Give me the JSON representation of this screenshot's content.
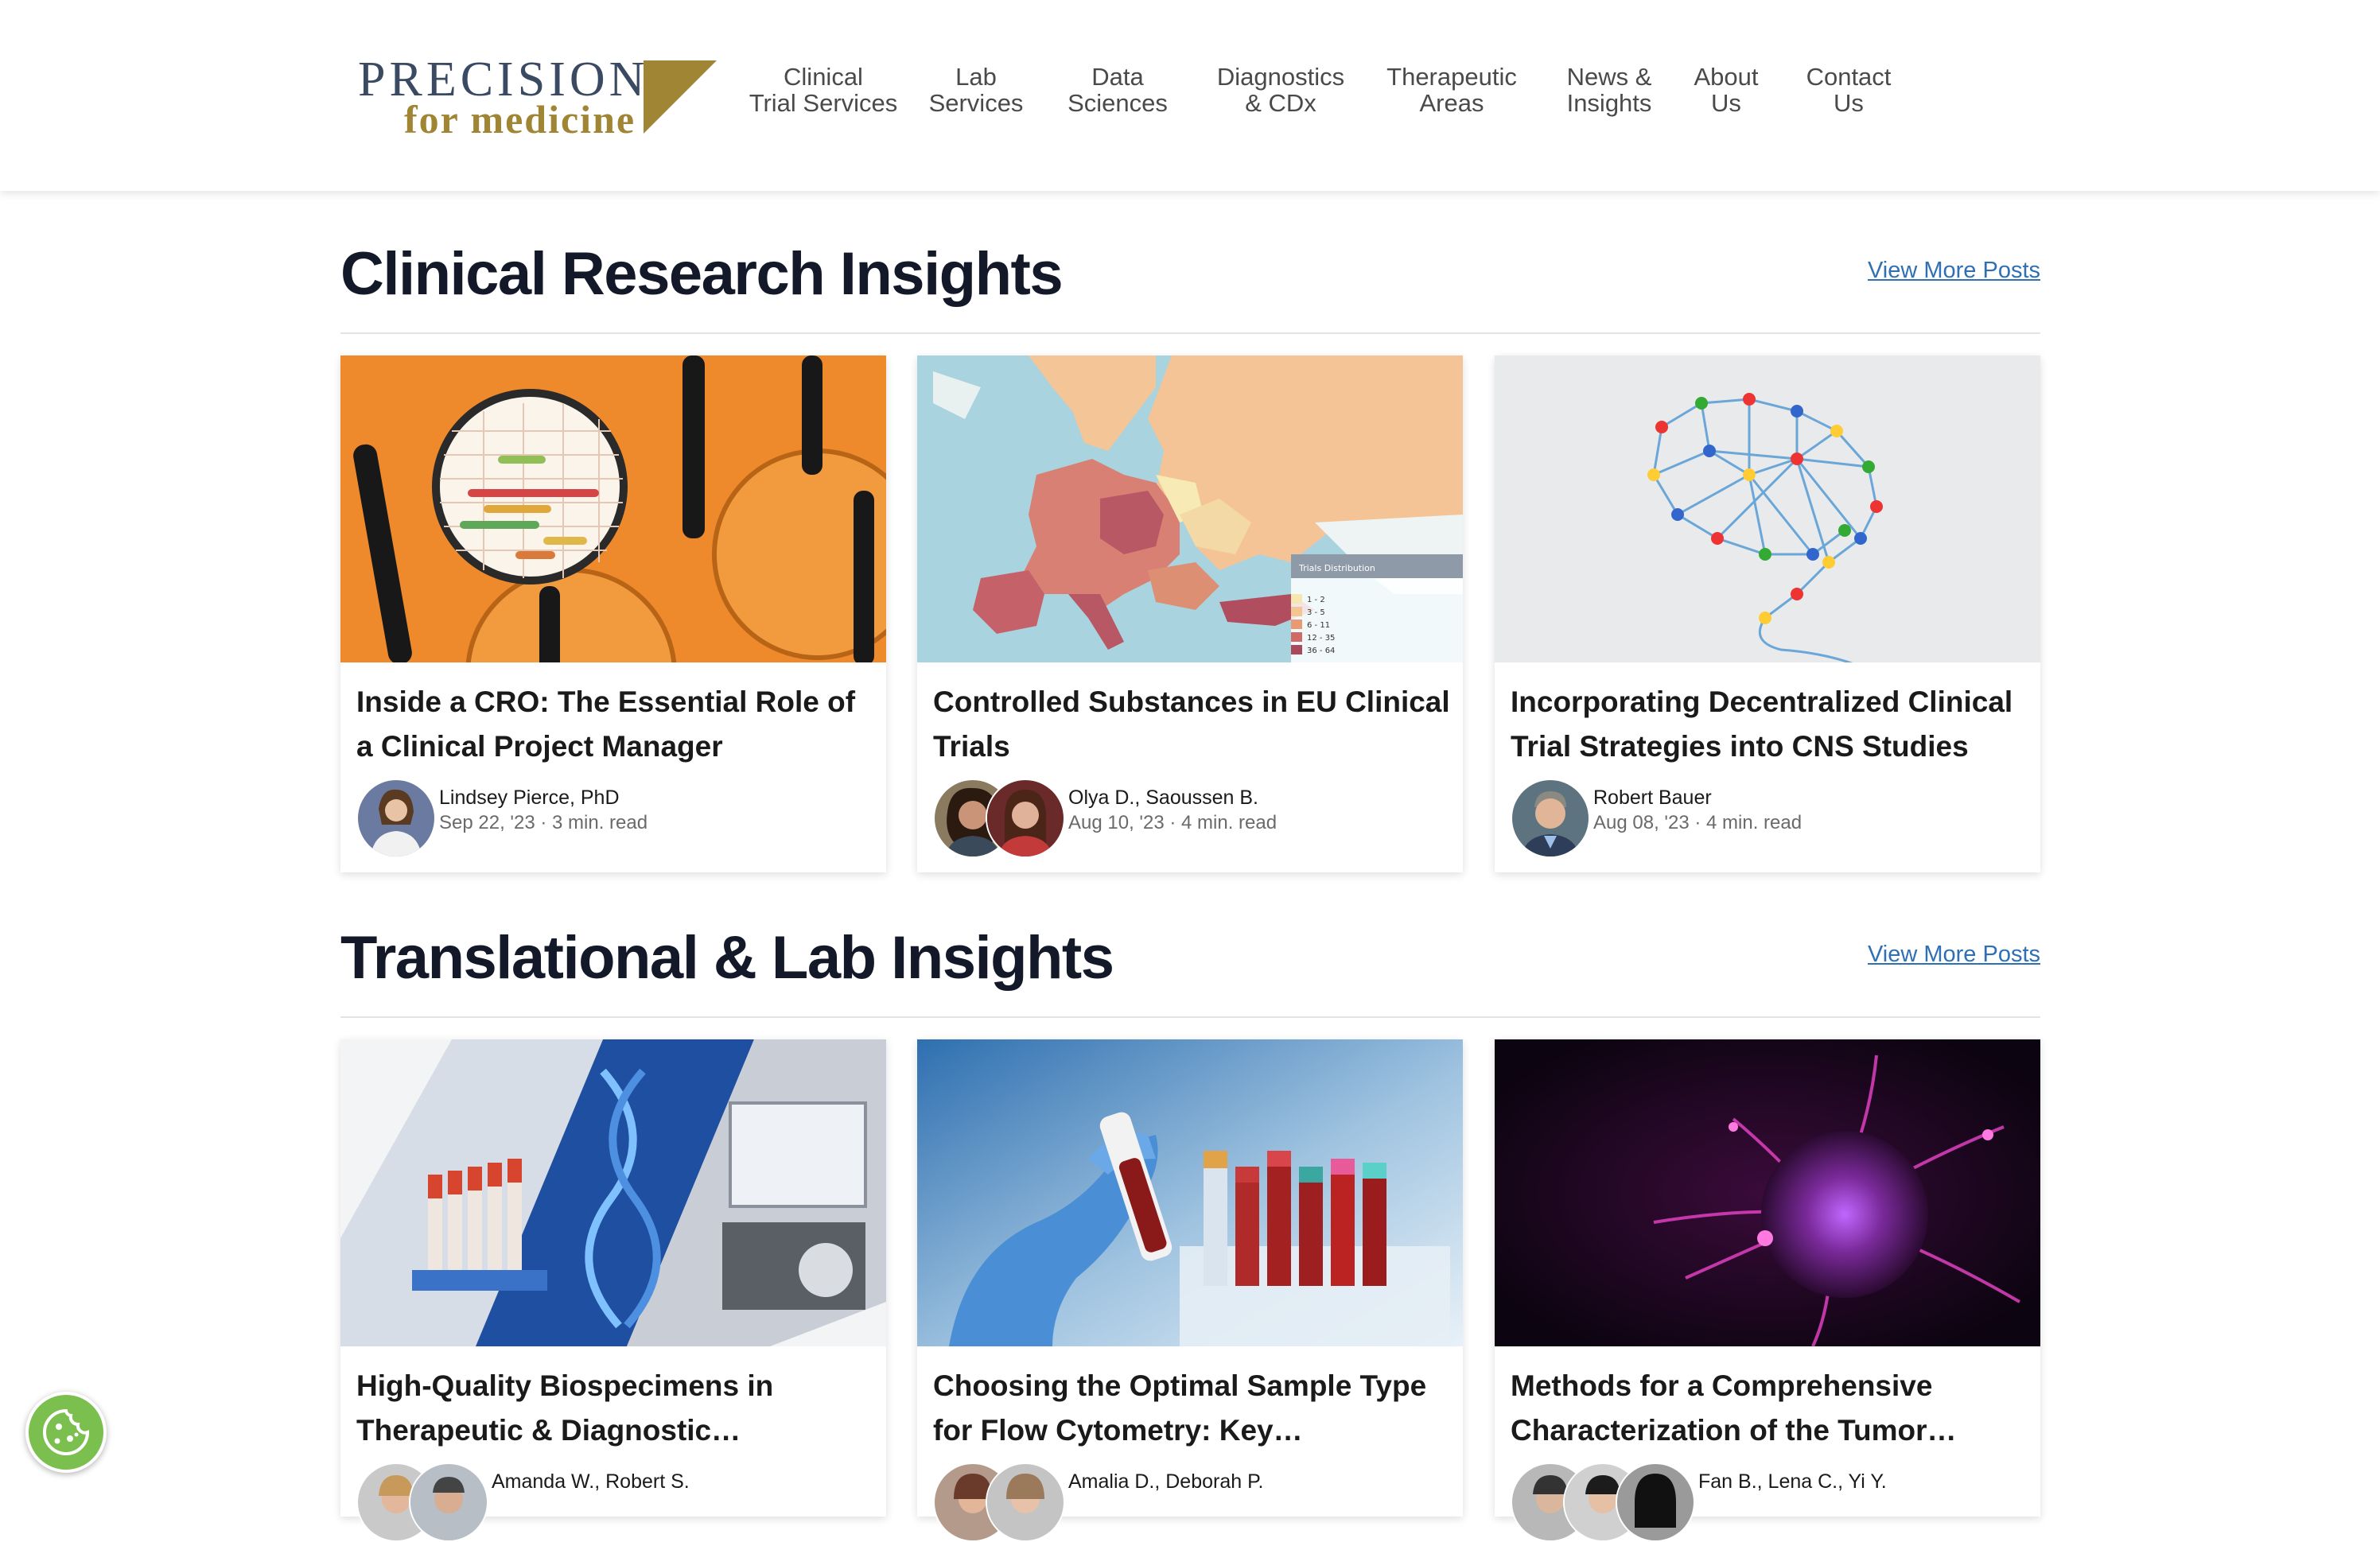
{
  "header": {
    "logo": {
      "line1": "PRECISION",
      "line2": "for medicine"
    },
    "nav": [
      {
        "label": "Clinical\nTrial Services"
      },
      {
        "label": "Lab\nServices"
      },
      {
        "label": "Data\nSciences"
      },
      {
        "label": "Diagnostics\n& CDx"
      },
      {
        "label": "Therapeutic\nAreas"
      },
      {
        "label": "News &\nInsights"
      },
      {
        "label": "About\nUs"
      },
      {
        "label": "Contact\nUs"
      }
    ]
  },
  "sections": [
    {
      "title": "Clinical Research Insights",
      "view_more": "View More Posts",
      "cards": [
        {
          "title": "Inside a CRO: The Essential Role of a Clinical Project Manager",
          "author": "Lindsey Pierce, PhD",
          "date": "Sep 22, '23",
          "read": "3 min. read",
          "image": "magnifying-glasses-gantt"
        },
        {
          "title": "Controlled Substances in EU Clinical Trials",
          "author": "Olya D., Saoussen B.",
          "date": "Aug 10, '23",
          "read": "4 min. read",
          "image": "europe-heat-map",
          "map_legend": {
            "title": "Trials Distribution",
            "items": [
              "1 - 2",
              "3 - 5",
              "6 - 11",
              "12 - 35",
              "36 - 64"
            ],
            "colors": [
              "#f6e7b0",
              "#f3c593",
              "#e79a73",
              "#d06a66",
              "#a84a5b"
            ]
          }
        },
        {
          "title": "Incorporating Decentralized Clinical Trial Strategies into CNS Studies",
          "author": "Robert Bauer",
          "date": "Aug 08, '23",
          "read": "4 min. read",
          "image": "pin-network-brain"
        }
      ]
    },
    {
      "title": "Translational & Lab Insights",
      "view_more": "View More Posts",
      "cards": [
        {
          "title": "High-Quality Biospecimens in Therapeutic & Diagnostic…",
          "author": "Amanda W., Robert S.",
          "date": "",
          "read": "",
          "image": "tubes-dna-lab"
        },
        {
          "title": "Choosing the Optimal Sample Type for Flow Cytometry: Key…",
          "author": "Amalia D., Deborah P.",
          "date": "",
          "read": "",
          "image": "gloved-hand-blood-tube"
        },
        {
          "title": "Methods for a Comprehensive Characterization of the Tumor…",
          "author": "Fan B., Lena C., Yi Y.",
          "date": "",
          "read": "",
          "image": "purple-tumor-cell"
        }
      ]
    }
  ],
  "colors": {
    "brand_navy": "#3a4a63",
    "brand_gold": "#a08634",
    "link": "#2f6fb4",
    "heading": "#14192a",
    "cookie": "#7bbf4e"
  },
  "icons": {
    "cookie_button": "cookie-settings-icon"
  }
}
